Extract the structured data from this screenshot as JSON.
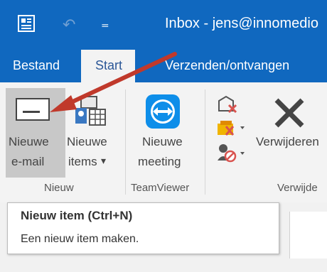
{
  "window": {
    "title": "Inbox - jens@innomedio"
  },
  "tabs": {
    "file": "Bestand",
    "start": "Start",
    "send_receive": "Verzenden/ontvangen"
  },
  "ribbon": {
    "new_email": {
      "line1": "Nieuwe",
      "line2": "e-mail"
    },
    "new_items": {
      "line1": "Nieuwe",
      "line2": "items",
      "dropdown": "▾"
    },
    "new_meeting": {
      "line1": "Nieuwe",
      "line2": "meeting"
    },
    "delete_label": "Verwijderen",
    "groups": {
      "new": "Nieuw",
      "teamviewer": "TeamViewer",
      "delete": "Verwijde"
    }
  },
  "tooltip": {
    "title": "Nieuw item (Ctrl+N)",
    "description": "Een nieuw item maken."
  },
  "colors": {
    "titlebar": "#1068bf",
    "ribbon": "#f3f3f3",
    "arrow": "#c0392b"
  },
  "icons": [
    "app-icon",
    "undo-icon",
    "qat-dropdown-icon",
    "envelope-icon",
    "new-items-icon",
    "teamviewer-icon",
    "ignore-icon",
    "cleanup-icon",
    "junk-icon",
    "delete-x-icon"
  ]
}
